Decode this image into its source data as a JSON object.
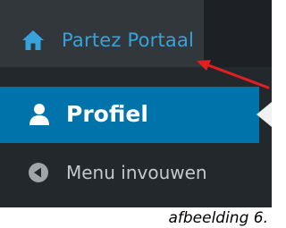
{
  "admin_bar": {
    "site_link_label": "Partez Portaal",
    "icon": "home-icon"
  },
  "menu": {
    "active_item": {
      "label": "Profiel",
      "icon": "user-icon"
    },
    "collapse": {
      "label": "Menu invouwen",
      "icon": "collapse-arrow-icon"
    }
  },
  "annotation": {
    "arrow_color": "#e02020"
  },
  "caption": "afbeelding 6.",
  "colors": {
    "link": "#36a3dd",
    "active_bg": "#0073aa",
    "menu_bg": "#23282d",
    "bar_bg": "#1d2125",
    "site_link_bg": "#32373c"
  }
}
